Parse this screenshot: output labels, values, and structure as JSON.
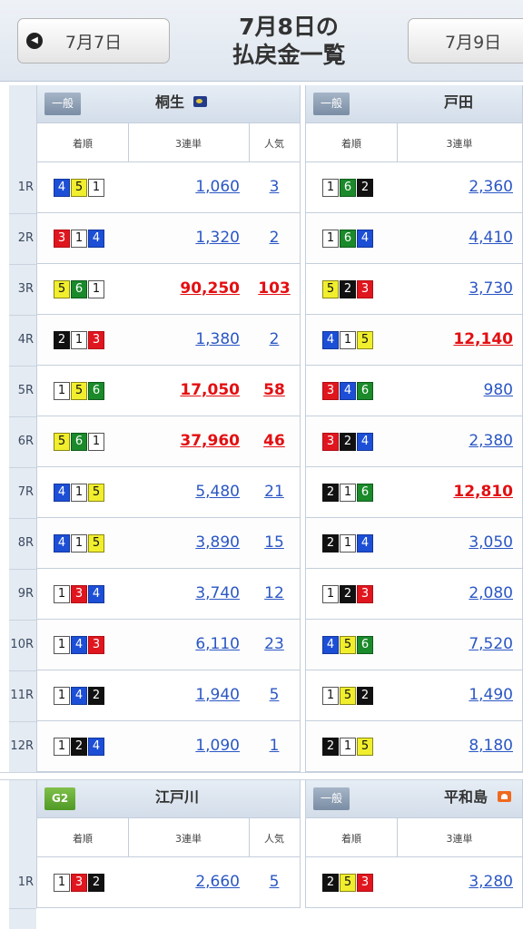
{
  "header": {
    "prev_label": "7月7日",
    "next_label": "7月9日",
    "title_line1": "7月8日の",
    "title_line2": "払戻金一覧"
  },
  "columns": {
    "order": "着順",
    "trifecta": "3連単",
    "popularity": "人気"
  },
  "race_labels": [
    "1R",
    "2R",
    "3R",
    "4R",
    "5R",
    "6R",
    "7R",
    "8R",
    "9R",
    "10R",
    "11R",
    "12R"
  ],
  "venues": [
    {
      "grade": "一般",
      "name": "桐生",
      "icon": "night-race-icon",
      "races": [
        {
          "order": [
            4,
            5,
            1
          ],
          "payout": "1,060",
          "pop": "3",
          "hi": false
        },
        {
          "order": [
            3,
            1,
            4
          ],
          "payout": "1,320",
          "pop": "2",
          "hi": false
        },
        {
          "order": [
            5,
            6,
            1
          ],
          "payout": "90,250",
          "pop": "103",
          "hi": true
        },
        {
          "order": [
            2,
            1,
            3
          ],
          "payout": "1,380",
          "pop": "2",
          "hi": false
        },
        {
          "order": [
            1,
            5,
            6
          ],
          "payout": "17,050",
          "pop": "58",
          "hi": true
        },
        {
          "order": [
            5,
            6,
            1
          ],
          "payout": "37,960",
          "pop": "46",
          "hi": true
        },
        {
          "order": [
            4,
            1,
            5
          ],
          "payout": "5,480",
          "pop": "21",
          "hi": false
        },
        {
          "order": [
            4,
            1,
            5
          ],
          "payout": "3,890",
          "pop": "15",
          "hi": false
        },
        {
          "order": [
            1,
            3,
            4
          ],
          "payout": "3,740",
          "pop": "12",
          "hi": false
        },
        {
          "order": [
            1,
            4,
            3
          ],
          "payout": "6,110",
          "pop": "23",
          "hi": false
        },
        {
          "order": [
            1,
            4,
            2
          ],
          "payout": "1,940",
          "pop": "5",
          "hi": false
        },
        {
          "order": [
            1,
            2,
            4
          ],
          "payout": "1,090",
          "pop": "1",
          "hi": false
        }
      ]
    },
    {
      "grade": "一般",
      "name": "戸田",
      "icon": "",
      "races": [
        {
          "order": [
            1,
            6,
            2
          ],
          "payout": "2,360",
          "hi": false
        },
        {
          "order": [
            1,
            6,
            4
          ],
          "payout": "4,410",
          "hi": false
        },
        {
          "order": [
            5,
            2,
            3
          ],
          "payout": "3,730",
          "hi": false
        },
        {
          "order": [
            4,
            1,
            5
          ],
          "payout": "12,140",
          "hi": true
        },
        {
          "order": [
            3,
            4,
            6
          ],
          "payout": "980",
          "hi": false
        },
        {
          "order": [
            3,
            2,
            4
          ],
          "payout": "2,380",
          "hi": false
        },
        {
          "order": [
            2,
            1,
            6
          ],
          "payout": "12,810",
          "hi": true
        },
        {
          "order": [
            2,
            1,
            4
          ],
          "payout": "3,050",
          "hi": false
        },
        {
          "order": [
            1,
            2,
            3
          ],
          "payout": "2,080",
          "hi": false
        },
        {
          "order": [
            4,
            5,
            6
          ],
          "payout": "7,520",
          "hi": false
        },
        {
          "order": [
            1,
            5,
            2
          ],
          "payout": "1,490",
          "hi": false
        },
        {
          "order": [
            2,
            1,
            5
          ],
          "payout": "8,180",
          "hi": false
        }
      ]
    },
    {
      "grade": "G2",
      "name": "江戸川",
      "icon": "",
      "races": [
        {
          "order": [
            1,
            3,
            2
          ],
          "payout": "2,660",
          "pop": "5",
          "hi": false
        }
      ]
    },
    {
      "grade": "一般",
      "name": "平和島",
      "icon": "morning-race-icon",
      "races": [
        {
          "order": [
            2,
            5,
            3
          ],
          "payout": "3,280",
          "hi": false
        }
      ]
    }
  ],
  "colors": {
    "link": "#2b57c4",
    "highlight": "#e30f12",
    "header_bg": "#dfe6ef"
  }
}
